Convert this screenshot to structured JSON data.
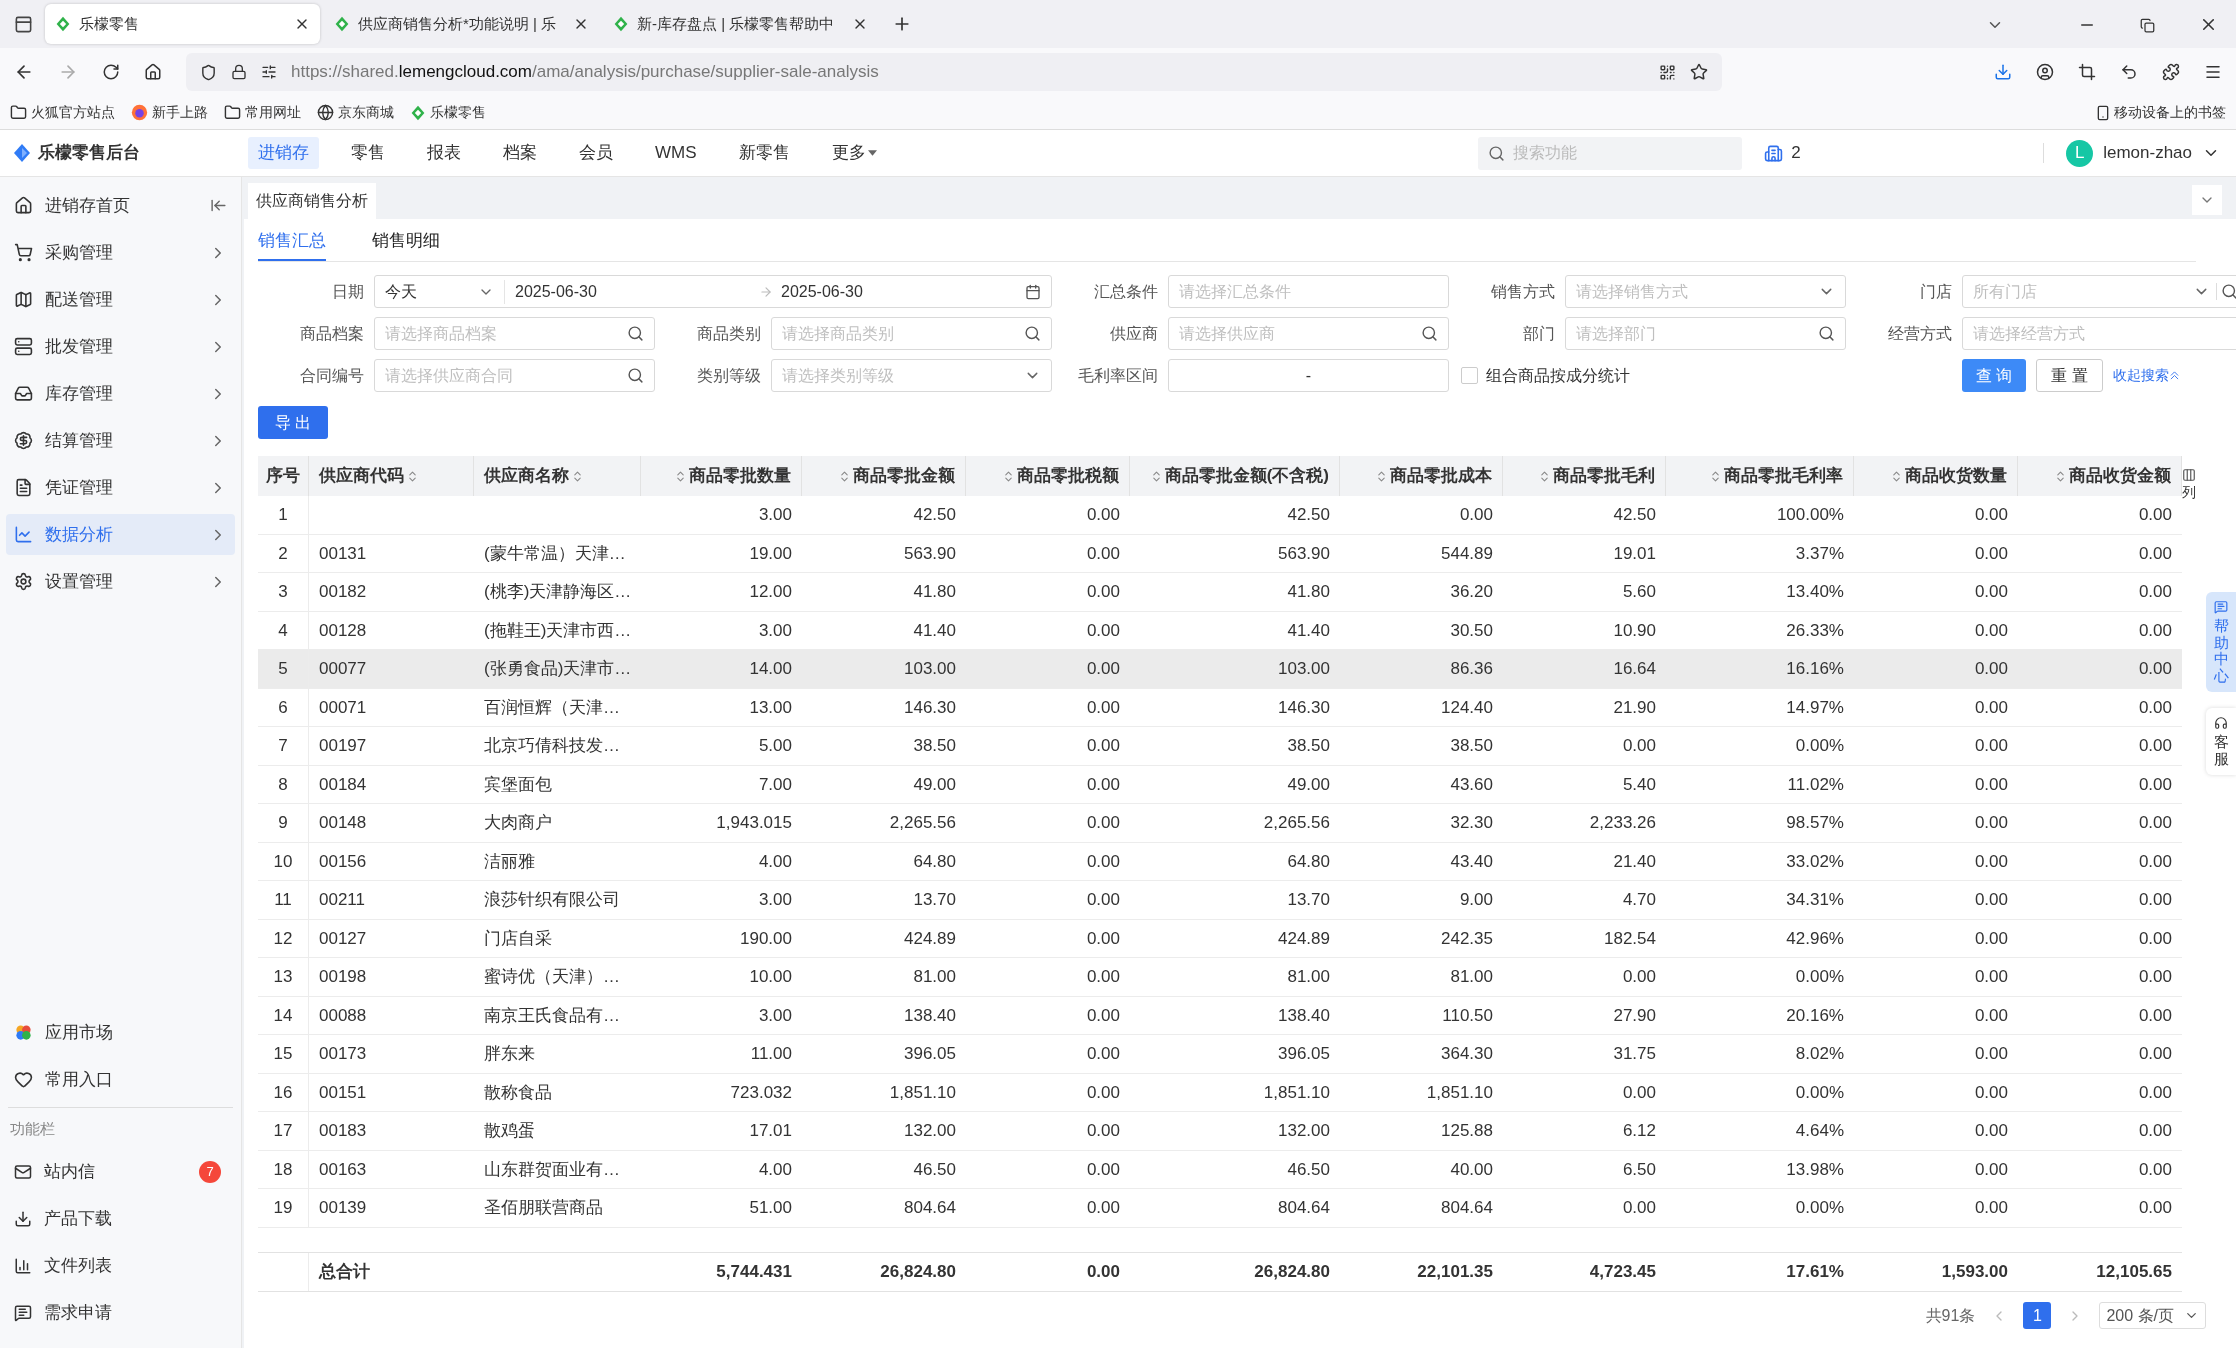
{
  "browser": {
    "tabs": [
      {
        "title": "乐檬零售",
        "selected": true
      },
      {
        "title": "供应商销售分析*功能说明 | 乐",
        "selected": false
      },
      {
        "title": "新-库存盘点 | 乐檬零售帮助中",
        "selected": false
      }
    ],
    "url": {
      "scheme": "https://shared.",
      "host": "lemengcloud.com",
      "path": "/ama/analysis/purchase/supplier-sale-analysis"
    },
    "bookmarks": [
      {
        "label": "火狐官方站点",
        "kind": "folder"
      },
      {
        "label": "新手上路",
        "kind": "browser"
      },
      {
        "label": "常用网址",
        "kind": "folder"
      },
      {
        "label": "京东商城",
        "kind": "globe"
      },
      {
        "label": "乐檬零售",
        "kind": "logo"
      }
    ],
    "mobile_bookmarks": "移动设备上的书签"
  },
  "header": {
    "brand": "乐檬零售后台",
    "nav": [
      {
        "label": "进销存",
        "selected": true
      },
      {
        "label": "零售",
        "selected": false
      },
      {
        "label": "报表",
        "selected": false
      },
      {
        "label": "档案",
        "selected": false
      },
      {
        "label": "会员",
        "selected": false
      },
      {
        "label": "WMS",
        "selected": false
      },
      {
        "label": "新零售",
        "selected": false
      },
      {
        "label": "更多",
        "selected": false,
        "dropdown": true
      }
    ],
    "search_placeholder": "搜索功能",
    "company": "2",
    "user": {
      "initial": "L",
      "name": "lemon-zhao"
    }
  },
  "sidebar": {
    "items": [
      {
        "label": "进销存首页",
        "selected": false,
        "has_children": false
      },
      {
        "label": "采购管理",
        "selected": false,
        "has_children": true
      },
      {
        "label": "配送管理",
        "selected": false,
        "has_children": true
      },
      {
        "label": "批发管理",
        "selected": false,
        "has_children": true
      },
      {
        "label": "库存管理",
        "selected": false,
        "has_children": true
      },
      {
        "label": "结算管理",
        "selected": false,
        "has_children": true
      },
      {
        "label": "凭证管理",
        "selected": false,
        "has_children": true
      },
      {
        "label": "数据分析",
        "selected": true,
        "has_children": true
      },
      {
        "label": "设置管理",
        "selected": false,
        "has_children": true
      }
    ],
    "links": [
      "应用市场",
      "常用入口"
    ],
    "section_title": "功能栏",
    "tools": [
      {
        "label": "站内信",
        "badge": "7"
      },
      {
        "label": "产品下载"
      },
      {
        "label": "文件列表"
      },
      {
        "label": "需求申请"
      }
    ]
  },
  "page_tab": "供应商销售分析",
  "subtabs": [
    {
      "label": "销售汇总",
      "selected": true
    },
    {
      "label": "销售明细",
      "selected": false
    }
  ],
  "filters": [
    {
      "kind": "date_range",
      "label": "日期",
      "preset": "今天",
      "start": "2025-06-30",
      "end": "2025-06-30"
    },
    {
      "kind": "input",
      "label": "汇总条件",
      "placeholder": "请选择汇总条件"
    },
    {
      "kind": "select",
      "label": "销售方式",
      "placeholder": "请选择销售方式"
    },
    {
      "kind": "select_search",
      "label": "门店",
      "placeholder": "所有门店"
    },
    {
      "kind": "search",
      "label": "商品档案",
      "placeholder": "请选择商品档案"
    },
    {
      "kind": "search",
      "label": "商品类别",
      "placeholder": "请选择商品类别"
    },
    {
      "kind": "search",
      "label": "供应商",
      "placeholder": "请选择供应商"
    },
    {
      "kind": "search",
      "label": "部门",
      "placeholder": "请选择部门"
    },
    {
      "kind": "input",
      "label": "经营方式",
      "placeholder": "请选择经营方式"
    },
    {
      "kind": "search",
      "label": "合同编号",
      "placeholder": "请选择供应商合同"
    },
    {
      "kind": "select",
      "label": "类别等级",
      "placeholder": "请选择类别等级"
    },
    {
      "kind": "range",
      "label": "毛利率区间",
      "separator": "-"
    },
    {
      "kind": "checkbox",
      "label": "组合商品按成分统计",
      "checked": false
    }
  ],
  "actions": {
    "query": "查 询",
    "reset": "重 置",
    "collapse": "收起搜索"
  },
  "export_button": "导 出",
  "table": {
    "columns": [
      {
        "label": "序号",
        "sortable": false
      },
      {
        "label": "供应商代码",
        "sortable": true
      },
      {
        "label": "供应商名称",
        "sortable": true
      },
      {
        "label": "商品零批数量",
        "sortable": true
      },
      {
        "label": "商品零批金额",
        "sortable": true
      },
      {
        "label": "商品零批税额",
        "sortable": true
      },
      {
        "label": "商品零批金额(不含税)",
        "sortable": true
      },
      {
        "label": "商品零批成本",
        "sortable": true
      },
      {
        "label": "商品零批毛利",
        "sortable": true
      },
      {
        "label": "商品零批毛利率",
        "sortable": true
      },
      {
        "label": "商品收货数量",
        "sortable": true
      },
      {
        "label": "商品收货金额",
        "sortable": true
      }
    ],
    "rows": [
      {
        "highlighted": false,
        "cells": [
          "1",
          null,
          null,
          "3.00",
          "42.50",
          "0.00",
          "42.50",
          "0.00",
          "42.50",
          "100.00%",
          "0.00",
          "0.00"
        ]
      },
      {
        "highlighted": false,
        "cells": [
          "2",
          "00131",
          "(蒙牛常温）天津…",
          "19.00",
          "563.90",
          "0.00",
          "563.90",
          "544.89",
          "19.01",
          "3.37%",
          "0.00",
          "0.00"
        ]
      },
      {
        "highlighted": false,
        "cells": [
          "3",
          "00182",
          "(桃李)天津静海区…",
          "12.00",
          "41.80",
          "0.00",
          "41.80",
          "36.20",
          "5.60",
          "13.40%",
          "0.00",
          "0.00"
        ]
      },
      {
        "highlighted": false,
        "cells": [
          "4",
          "00128",
          "(拖鞋王)天津市西…",
          "3.00",
          "41.40",
          "0.00",
          "41.40",
          "30.50",
          "10.90",
          "26.33%",
          "0.00",
          "0.00"
        ]
      },
      {
        "highlighted": true,
        "cells": [
          "5",
          "00077",
          "(张勇食品)天津市…",
          "14.00",
          "103.00",
          "0.00",
          "103.00",
          "86.36",
          "16.64",
          "16.16%",
          "0.00",
          "0.00"
        ]
      },
      {
        "highlighted": false,
        "cells": [
          "6",
          "00071",
          "百润恒辉（天津…",
          "13.00",
          "146.30",
          "0.00",
          "146.30",
          "124.40",
          "21.90",
          "14.97%",
          "0.00",
          "0.00"
        ]
      },
      {
        "highlighted": false,
        "cells": [
          "7",
          "00197",
          "北京巧倩科技发…",
          "5.00",
          "38.50",
          "0.00",
          "38.50",
          "38.50",
          "0.00",
          "0.00%",
          "0.00",
          "0.00"
        ]
      },
      {
        "highlighted": false,
        "cells": [
          "8",
          "00184",
          "宾堡面包",
          "7.00",
          "49.00",
          "0.00",
          "49.00",
          "43.60",
          "5.40",
          "11.02%",
          "0.00",
          "0.00"
        ]
      },
      {
        "highlighted": false,
        "cells": [
          "9",
          "00148",
          "大肉商户",
          "1,943.015",
          "2,265.56",
          "0.00",
          "2,265.56",
          "32.30",
          "2,233.26",
          "98.57%",
          "0.00",
          "0.00"
        ]
      },
      {
        "highlighted": false,
        "cells": [
          "10",
          "00156",
          "洁丽雅",
          "4.00",
          "64.80",
          "0.00",
          "64.80",
          "43.40",
          "21.40",
          "33.02%",
          "0.00",
          "0.00"
        ]
      },
      {
        "highlighted": false,
        "cells": [
          "11",
          "00211",
          "浪莎针织有限公司",
          "3.00",
          "13.70",
          "0.00",
          "13.70",
          "9.00",
          "4.70",
          "34.31%",
          "0.00",
          "0.00"
        ]
      },
      {
        "highlighted": false,
        "cells": [
          "12",
          "00127",
          "门店自采",
          "190.00",
          "424.89",
          "0.00",
          "424.89",
          "242.35",
          "182.54",
          "42.96%",
          "0.00",
          "0.00"
        ]
      },
      {
        "highlighted": false,
        "cells": [
          "13",
          "00198",
          "蜜诗优（天津）…",
          "10.00",
          "81.00",
          "0.00",
          "81.00",
          "81.00",
          "0.00",
          "0.00%",
          "0.00",
          "0.00"
        ]
      },
      {
        "highlighted": false,
        "cells": [
          "14",
          "00088",
          "南京王氏食品有…",
          "3.00",
          "138.40",
          "0.00",
          "138.40",
          "110.50",
          "27.90",
          "20.16%",
          "0.00",
          "0.00"
        ]
      },
      {
        "highlighted": false,
        "cells": [
          "15",
          "00173",
          "胖东来",
          "11.00",
          "396.05",
          "0.00",
          "396.05",
          "364.30",
          "31.75",
          "8.02%",
          "0.00",
          "0.00"
        ]
      },
      {
        "highlighted": false,
        "cells": [
          "16",
          "00151",
          "散称食品",
          "723.032",
          "1,851.10",
          "0.00",
          "1,851.10",
          "1,851.10",
          "0.00",
          "0.00%",
          "0.00",
          "0.00"
        ]
      },
      {
        "highlighted": false,
        "cells": [
          "17",
          "00183",
          "散鸡蛋",
          "17.01",
          "132.00",
          "0.00",
          "132.00",
          "125.88",
          "6.12",
          "4.64%",
          "0.00",
          "0.00"
        ]
      },
      {
        "highlighted": false,
        "cells": [
          "18",
          "00163",
          "山东群贺面业有…",
          "4.00",
          "46.50",
          "0.00",
          "46.50",
          "40.00",
          "6.50",
          "13.98%",
          "0.00",
          "0.00"
        ]
      },
      {
        "highlighted": false,
        "cells": [
          "19",
          "00139",
          "圣佰朋联营商品",
          "51.00",
          "804.64",
          "0.00",
          "804.64",
          "804.64",
          "0.00",
          "0.00%",
          "0.00",
          "0.00"
        ]
      }
    ],
    "totals": {
      "label": "总合计",
      "values": [
        "5,744.431",
        "26,824.80",
        "0.00",
        "26,824.80",
        "22,101.35",
        "4,723.45",
        "17.61%",
        "1,593.00",
        "12,105.65"
      ]
    },
    "column_settings": "列"
  },
  "pagination": {
    "total": "共91条",
    "pages": [
      {
        "label": "1",
        "selected": true
      }
    ],
    "page_size": "200 条/页"
  },
  "float_tabs": [
    {
      "label": "帮助中心",
      "kind": "help"
    },
    {
      "label": "客服",
      "kind": "service"
    }
  ]
}
